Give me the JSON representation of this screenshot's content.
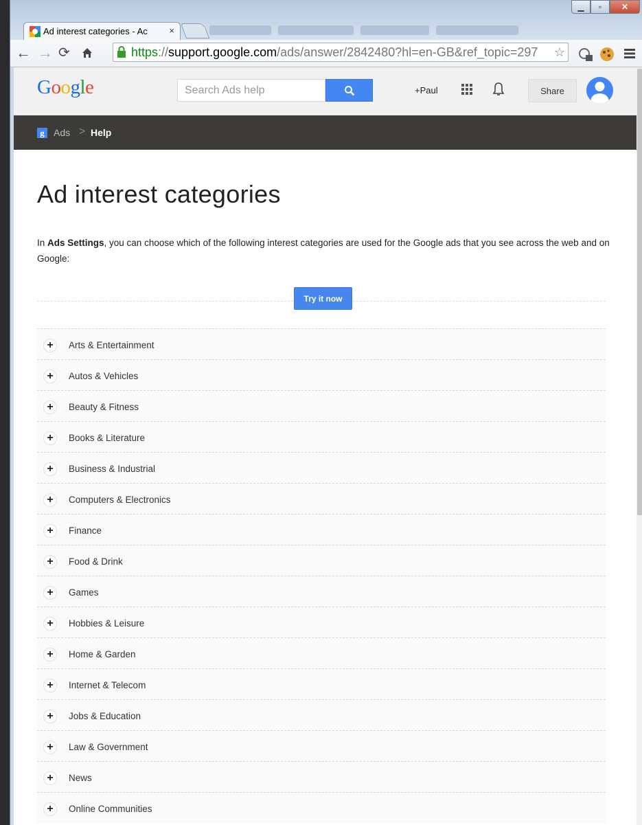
{
  "browser": {
    "tab_title": "Ad interest categories - Ac",
    "tab_close": "×",
    "url_https": "https",
    "url_sep": "://",
    "url_host": "support.google.com",
    "url_path": "/ads/answer/2842480?hl=en-GB&ref_topic=297"
  },
  "header": {
    "logo_letters": [
      {
        "ch": "G",
        "color": "#1a6ee6"
      },
      {
        "ch": "o",
        "color": "#dd4b39"
      },
      {
        "ch": "o",
        "color": "#f2b800"
      },
      {
        "ch": "g",
        "color": "#1a6ee6"
      },
      {
        "ch": "l",
        "color": "#2b9a3c"
      },
      {
        "ch": "e",
        "color": "#dd4b39"
      }
    ],
    "search_placeholder": "Search Ads help",
    "user_link": "+Paul",
    "share_label": "Share"
  },
  "breadcrumb": {
    "badge": "g",
    "ads": "Ads",
    "separator": ">",
    "help": "Help"
  },
  "main": {
    "title": "Ad interest categories",
    "intro_prefix": "In ",
    "intro_bold": "Ads Settings",
    "intro_rest": ", you can choose which of the following interest categories are used for the Google ads that you see across the web and on Google:",
    "try_button": "Try it now",
    "categories": [
      "Arts & Entertainment",
      "Autos & Vehicles",
      "Beauty & Fitness",
      "Books & Literature",
      "Business & Industrial",
      "Computers & Electronics",
      "Finance",
      "Food & Drink",
      "Games",
      "Hobbies & Leisure",
      "Home & Garden",
      "Internet & Telecom",
      "Jobs & Education",
      "Law & Government",
      "News",
      "Online Communities"
    ],
    "expand_symbol": "+"
  },
  "colors": {
    "accent_blue": "#4487f2",
    "breadcrumb_bar": "#3c3b37"
  }
}
